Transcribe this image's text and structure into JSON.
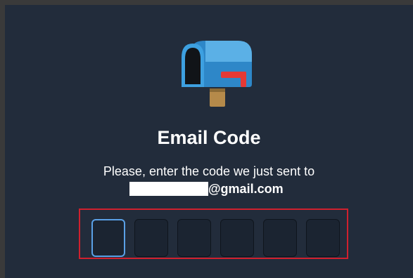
{
  "dialog": {
    "title": "Email Code",
    "instruction": "Please, enter the code we just sent to",
    "email_suffix": "@gmail.com"
  },
  "icons": {
    "header": "mailbox-icon"
  },
  "code_input": {
    "length": 6,
    "values": [
      "",
      "",
      "",
      "",
      "",
      ""
    ],
    "focused_index": 0
  },
  "colors": {
    "background": "#222c3b",
    "highlight_border": "#d0202e",
    "focus_border": "#5aa0e6"
  }
}
